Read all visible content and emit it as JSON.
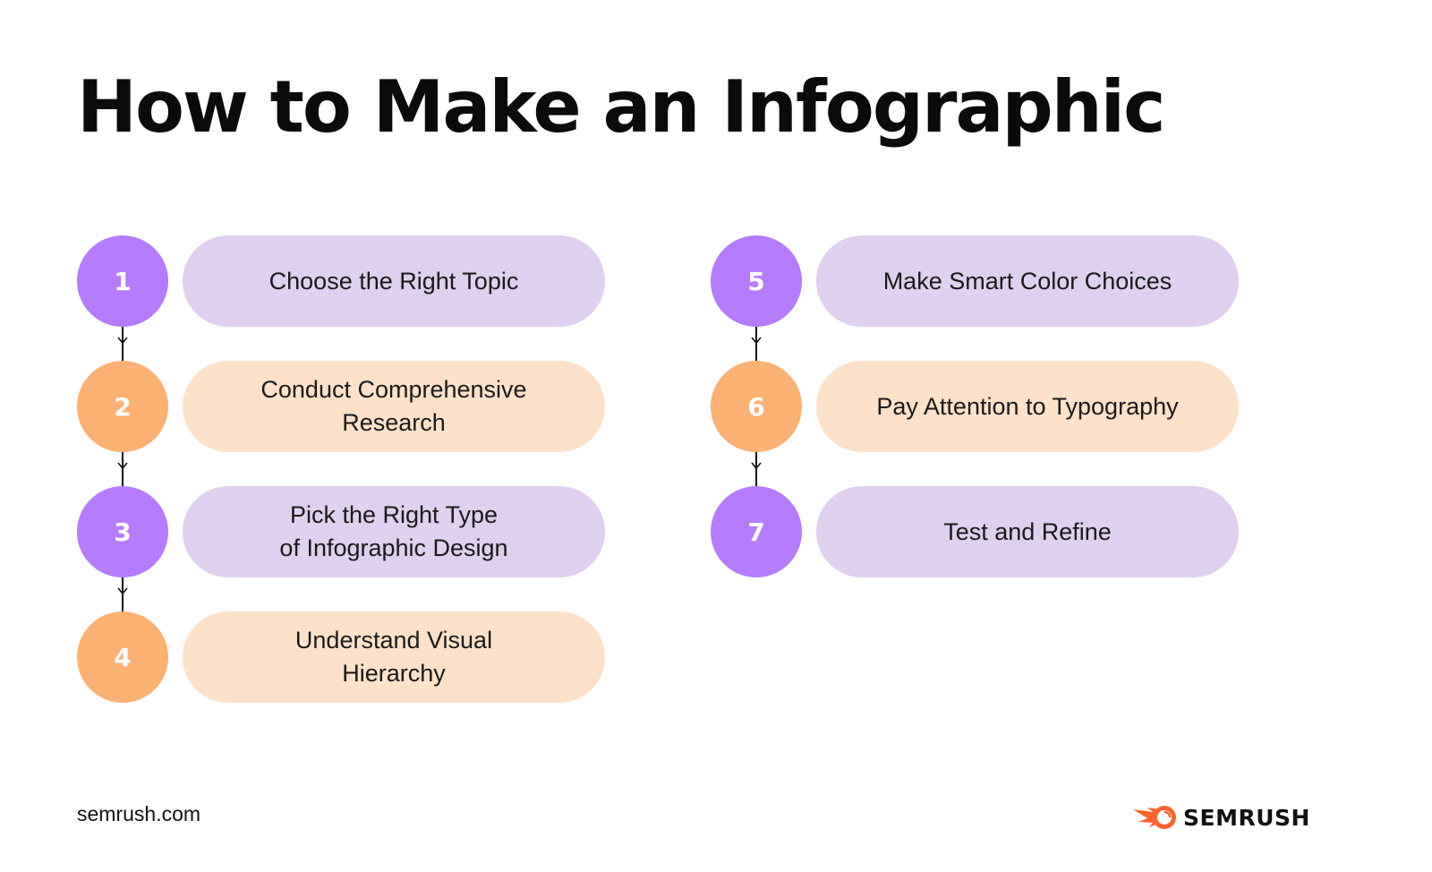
{
  "title": "How to Make an Infographic",
  "colors": {
    "purple_circle": "#B57BFC",
    "purple_pill": "#DED0EE",
    "orange_circle": "#FDB172",
    "orange_pill": "#FDE2C9",
    "connector": "#111111",
    "logo_orange": "#FF642D",
    "text": "#111111"
  },
  "columns": [
    {
      "steps": [
        {
          "number": "1",
          "label": "Choose the Right Topic",
          "theme": "purple"
        },
        {
          "number": "2",
          "label": "Conduct Comprehensive\nResearch",
          "theme": "orange"
        },
        {
          "number": "3",
          "label": "Pick the Right Type\nof Infographic Design",
          "theme": "purple"
        },
        {
          "number": "4",
          "label": "Understand Visual\nHierarchy",
          "theme": "orange"
        }
      ]
    },
    {
      "steps": [
        {
          "number": "5",
          "label": "Make Smart Color Choices",
          "theme": "purple"
        },
        {
          "number": "6",
          "label": "Pay Attention to Typography",
          "theme": "orange"
        },
        {
          "number": "7",
          "label": "Test and Refine",
          "theme": "purple"
        }
      ]
    }
  ],
  "footer": {
    "url": "semrush.com",
    "logo_text": "SEMRUSH",
    "logo_icon": "semrush-fireball-icon"
  }
}
